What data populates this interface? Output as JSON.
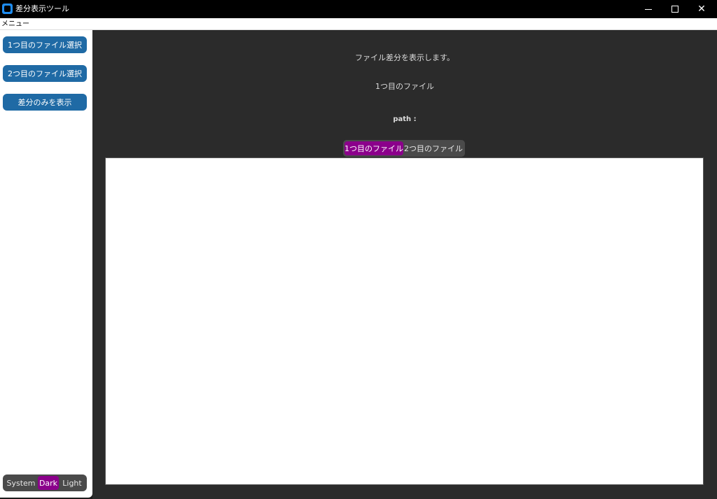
{
  "window": {
    "title": "差分表示ツール",
    "icon": "app-icon"
  },
  "menubar": {
    "menu_label": "メニュー"
  },
  "sidebar": {
    "buttons": [
      {
        "label": "1つ目のファイル選択"
      },
      {
        "label": "2つ目のファイル選択"
      },
      {
        "label": "差分のみを表示"
      }
    ],
    "appearance": {
      "options": [
        "System",
        "Dark",
        "Light"
      ],
      "selected": "Dark"
    }
  },
  "main": {
    "description": "ファイル差分を表示します。",
    "file_label": "1つ目のファイル",
    "path_label": "path :",
    "tabs": [
      {
        "label": "1つ目のファイル",
        "selected": true
      },
      {
        "label": "2つ目のファイル",
        "selected": false
      }
    ],
    "text_content": ""
  },
  "colors": {
    "accent_button": "#1f6aa5",
    "selected_segment": "#8b008b",
    "main_background": "#2b2b2b"
  }
}
